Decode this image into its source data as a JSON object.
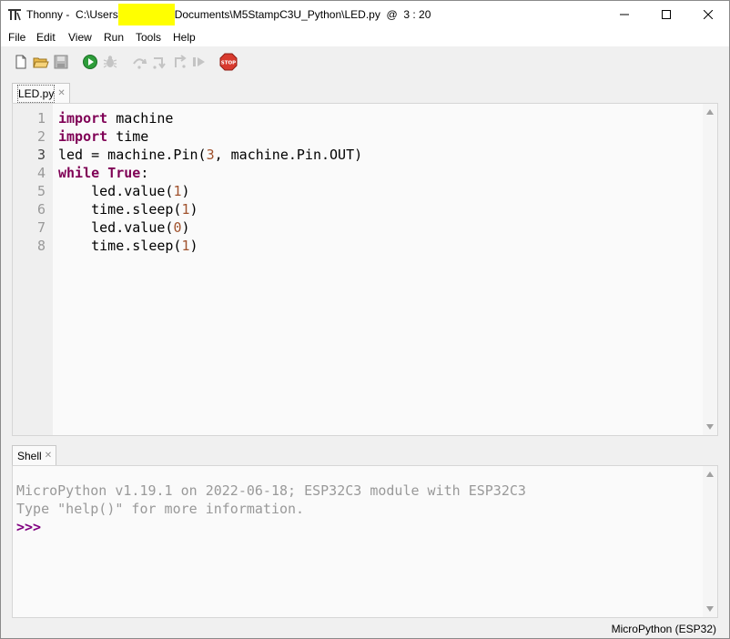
{
  "window": {
    "app_name": "Thonny",
    "sep": " - ",
    "path_prefix": "C:\\Users",
    "path_suffix": "Documents\\M5StampC3U_Python\\LED.py",
    "at": "@",
    "cursor_pos": "3 : 20"
  },
  "menu": [
    "File",
    "Edit",
    "View",
    "Run",
    "Tools",
    "Help"
  ],
  "toolbar": {
    "icons": [
      "new-file-icon",
      "open-file-icon",
      "save-icon",
      "run-icon",
      "debug-icon",
      "step-over-icon",
      "step-into-icon",
      "step-out-icon",
      "resume-icon",
      "stop-icon"
    ],
    "stop_label": "STOP"
  },
  "editor": {
    "tab_label": "LED.py",
    "line_numbers": [
      "1",
      "2",
      "3",
      "4",
      "5",
      "6",
      "7",
      "8"
    ],
    "current_line": 3
  },
  "shell": {
    "tab_label": "Shell",
    "line1": "MicroPython v1.19.1 on 2022-06-18; ESP32C3 module with ESP32C3",
    "line2": "Type \"help()\" for more information.",
    "prompt": ">>>"
  },
  "status": {
    "interpreter": "MicroPython (ESP32)"
  },
  "colors": {
    "keyword": "#7f0055",
    "number": "#a0522d",
    "prompt": "#800080",
    "redaction": "#ffff00",
    "stop_button": "#d83a2e"
  }
}
